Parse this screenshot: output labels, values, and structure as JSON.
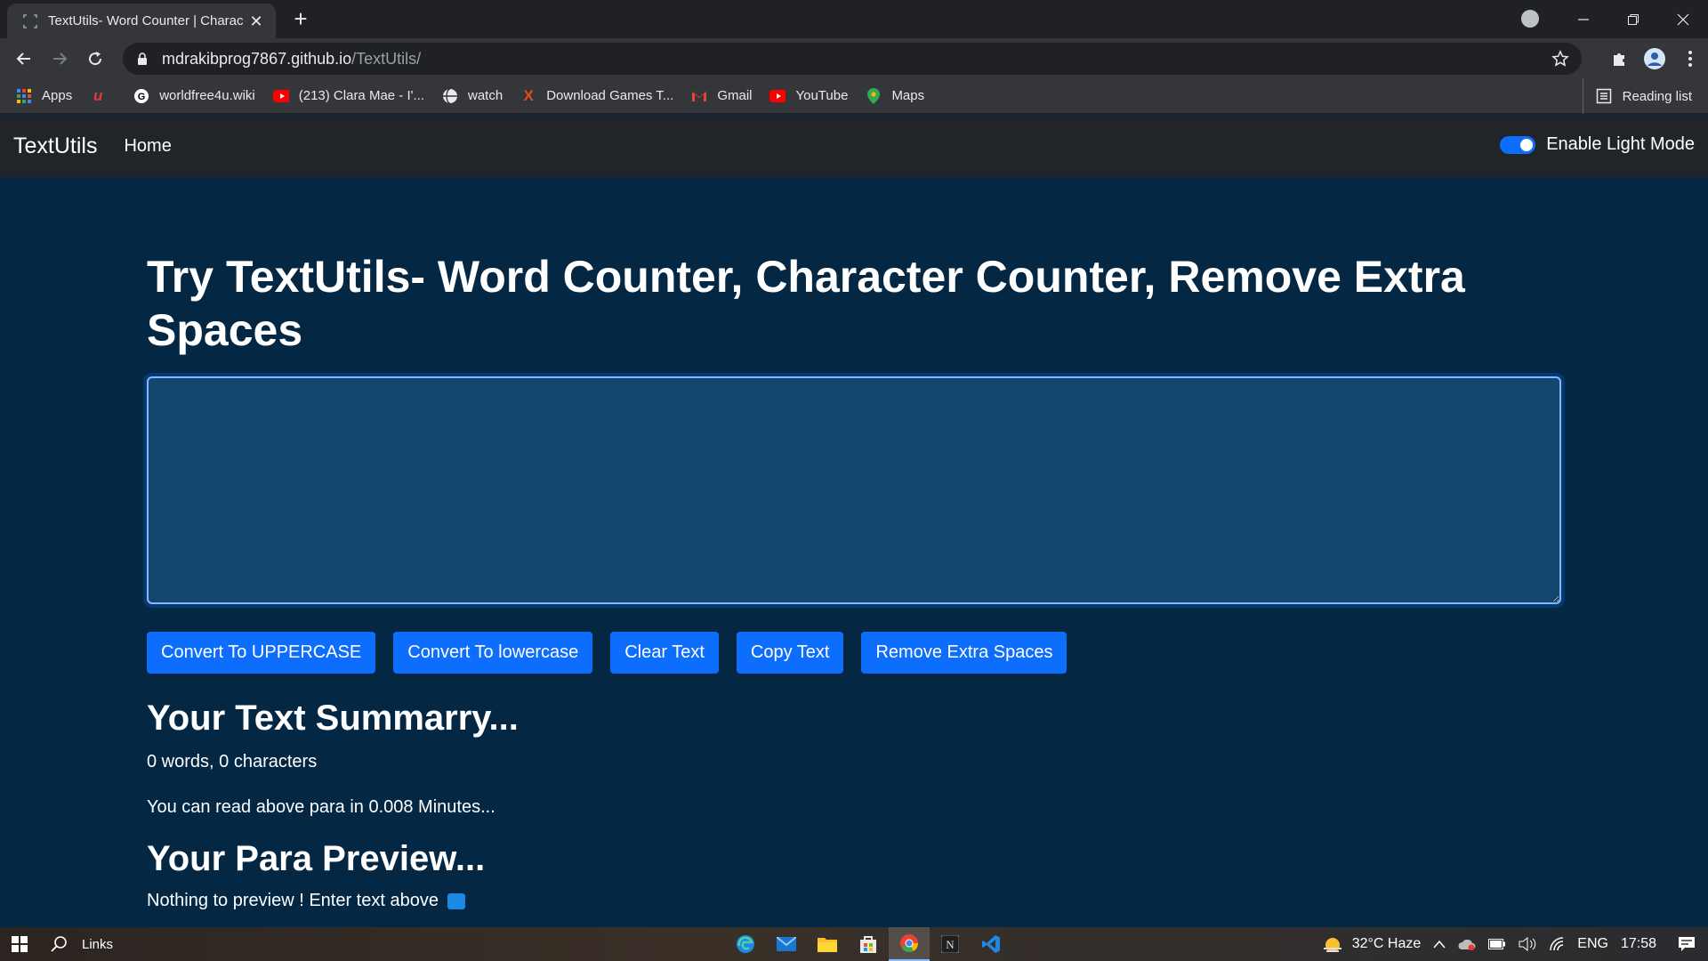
{
  "browser": {
    "tab_title": "TextUtils- Word Counter | Charac",
    "url_host": "mdrakibprog7867.github.io",
    "url_path": "/TextUtils/",
    "bookmarks": [
      {
        "label": "Apps",
        "icon": "apps-grid-icon"
      },
      {
        "label": "",
        "icon": "u-logo-icon"
      },
      {
        "label": "worldfree4u.wiki",
        "icon": "g-logo-icon"
      },
      {
        "label": "(213) Clara Mae - I'...",
        "icon": "youtube-icon"
      },
      {
        "label": "watch",
        "icon": "globe-icon"
      },
      {
        "label": "Download Games T...",
        "icon": "x-logo-icon"
      },
      {
        "label": "Gmail",
        "icon": "gmail-icon"
      },
      {
        "label": "YouTube",
        "icon": "youtube-icon"
      },
      {
        "label": "Maps",
        "icon": "maps-pin-icon"
      }
    ],
    "reading_list": "Reading list"
  },
  "navbar": {
    "brand": "TextUtils",
    "home": "Home",
    "mode_toggle_label": "Enable Light Mode"
  },
  "main": {
    "heading": "Try TextUtils- Word Counter, Character Counter, Remove Extra Spaces",
    "textarea_value": "",
    "buttons": [
      "Convert To UPPERCASE",
      "Convert To lowercase",
      "Clear Text",
      "Copy Text",
      "Remove Extra Spaces"
    ],
    "summary_title": "Your Text Summarry...",
    "counts": "0 words, 0 characters",
    "read_time": "You can read above para in 0.008 Minutes...",
    "preview_title": "Your Para Preview...",
    "preview_text": "Nothing to preview ! Enter text above"
  },
  "taskbar": {
    "search_label": "Links",
    "weather": "32°C  Haze",
    "language": "ENG",
    "time": "17:58"
  },
  "colors": {
    "page_bg": "#042743",
    "navbar_bg": "#212529",
    "button_bg": "#0d6efd",
    "textarea_bg": "#13466e"
  }
}
